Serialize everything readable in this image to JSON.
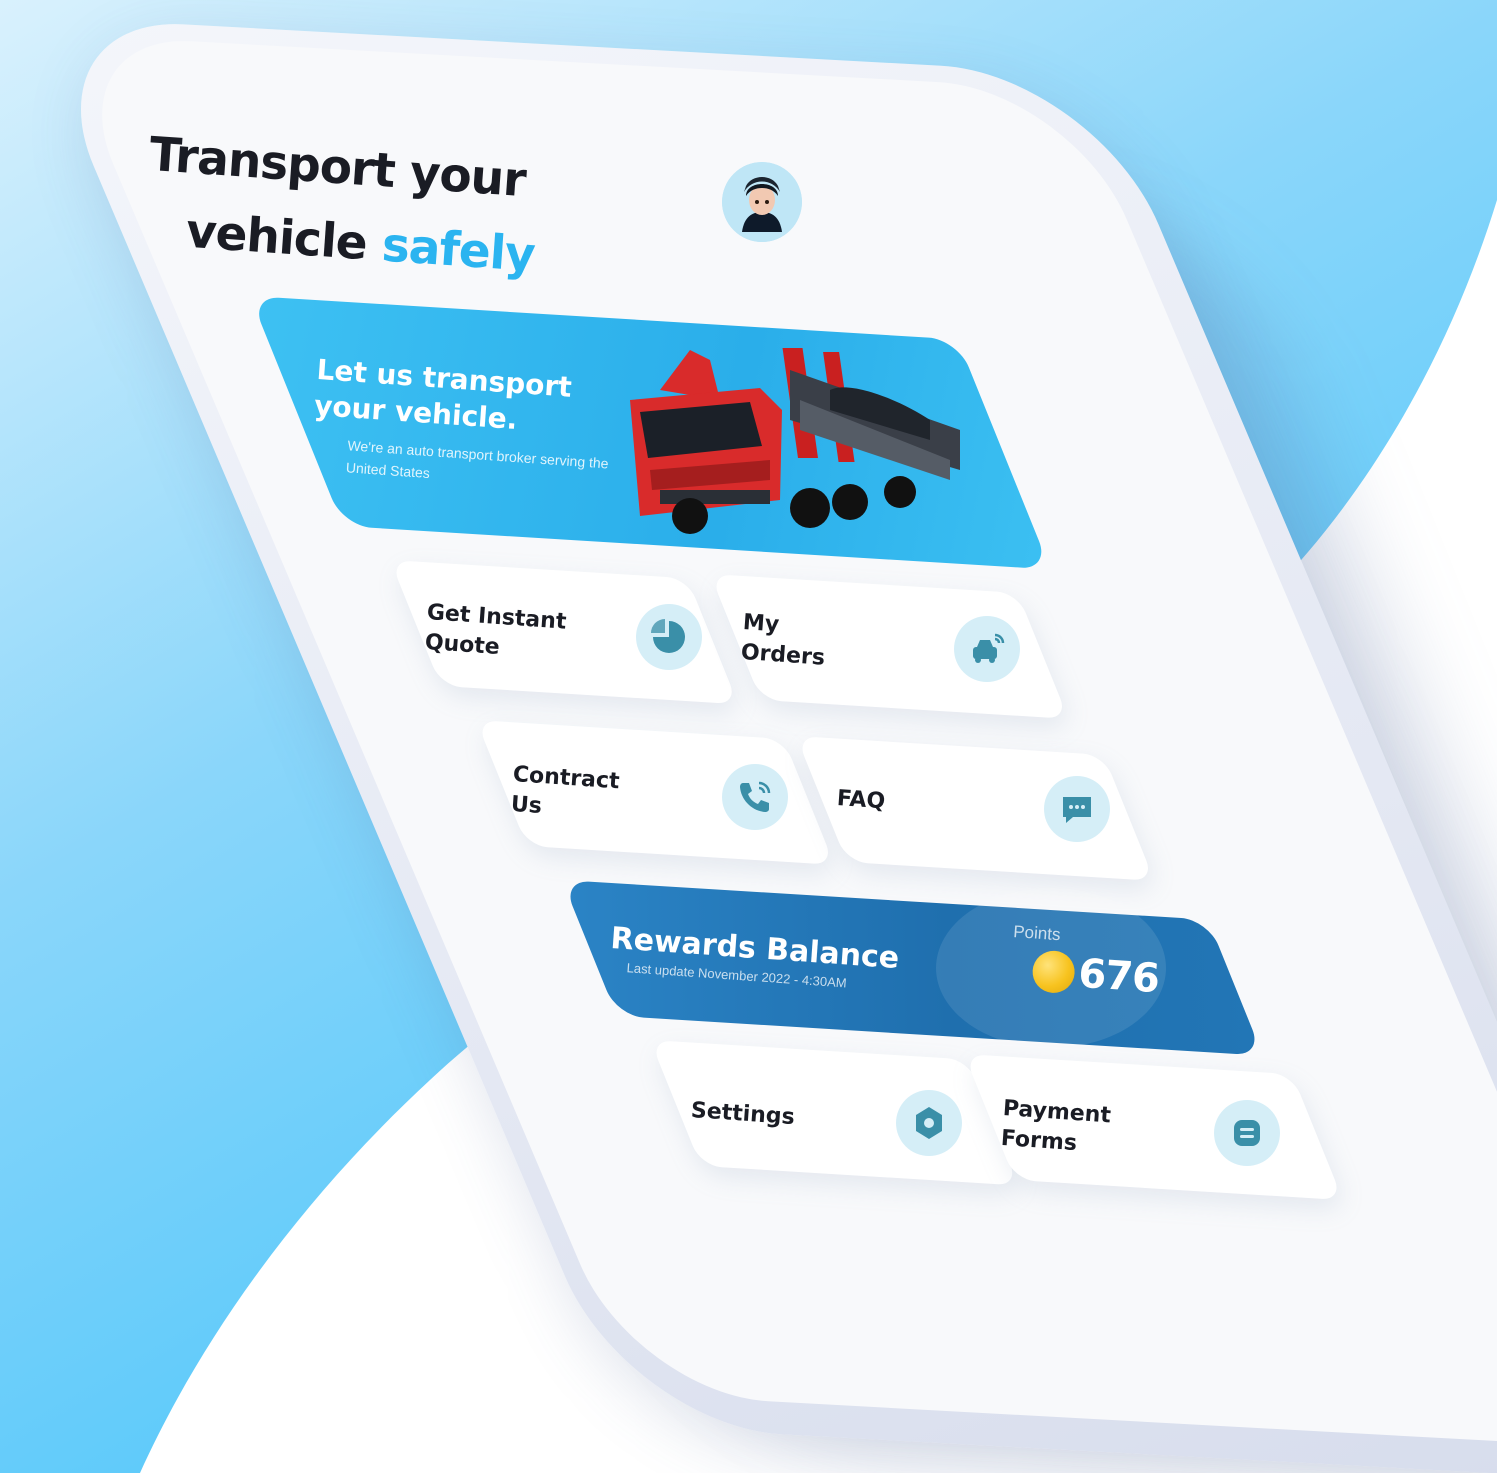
{
  "header": {
    "title_line1": "Transport your",
    "title_line2_plain": "vehicle",
    "title_line2_accent": "safely"
  },
  "hero": {
    "title": "Let us transport your vehicle.",
    "subtitle": "We're an auto transport broker serving the United States"
  },
  "menu": {
    "items": [
      {
        "label": "Get Instant\nQuote",
        "icon": "quote-pie-icon"
      },
      {
        "label": "My\nOrders",
        "icon": "car-signal-icon"
      },
      {
        "label": "Contract\nUs",
        "icon": "phone-call-icon"
      },
      {
        "label": "FAQ",
        "icon": "chat-bubble-icon"
      },
      {
        "label": "Settings",
        "icon": "gear-icon"
      },
      {
        "label": "Payment\nForms",
        "icon": "card-icon"
      }
    ]
  },
  "rewards": {
    "title": "Rewards Balance",
    "last_update": "Last update November 2022 - 4:30AM",
    "points_label": "Points",
    "points_value": "676"
  },
  "colors": {
    "accent": "#2bb4f0",
    "hero": "#3ec1f3",
    "rewards": "#1f6fae",
    "icon_bg": "#d5eef7",
    "icon_fg": "#3a8fa8"
  }
}
